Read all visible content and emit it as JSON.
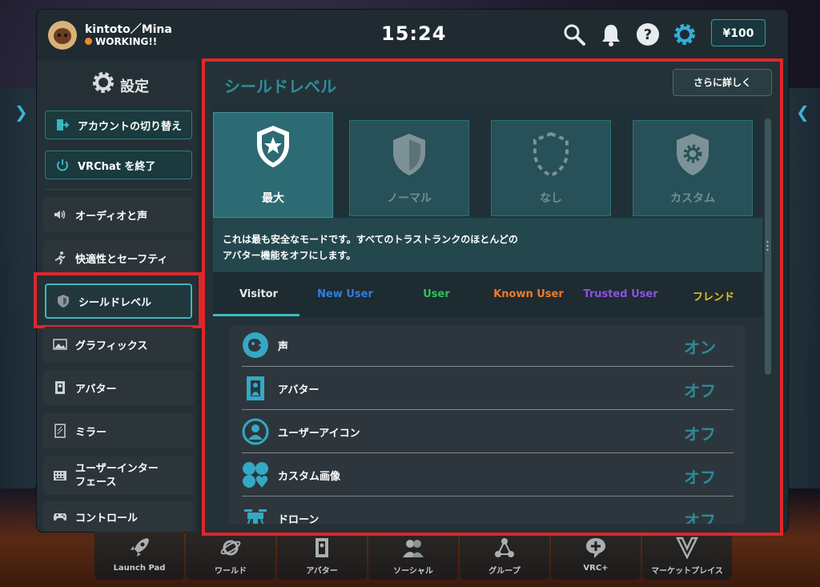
{
  "user": {
    "name": "kintoto／Mina",
    "status": "WORKING!!"
  },
  "clock": "15:24",
  "currency": "¥100",
  "sidebar": {
    "title": "設定",
    "buttons": [
      {
        "label": "アカウントの切り替え",
        "icon": "switch-account-icon"
      },
      {
        "label": "VRChat を終了",
        "icon": "power-icon"
      }
    ],
    "items": [
      {
        "label": "オーディオと声",
        "icon": "speaker-icon"
      },
      {
        "label": "快適性とセーフティ",
        "icon": "running-figure-icon"
      },
      {
        "label": "シールドレベル",
        "icon": "shield-icon"
      },
      {
        "label": "グラフィックス",
        "icon": "image-icon"
      },
      {
        "label": "アバター",
        "icon": "avatar-icon"
      },
      {
        "label": "ミラー",
        "icon": "mirror-icon"
      },
      {
        "label": "ユーザーインター",
        "label2": "フェース",
        "icon": "keyboard-icon"
      },
      {
        "label": "コントロール",
        "icon": "gamepad-icon"
      }
    ]
  },
  "main": {
    "title": "シールドレベル",
    "more_label": "さらに詳しく",
    "shields": [
      {
        "label": "最大",
        "active": true
      },
      {
        "label": "ノーマル"
      },
      {
        "label": "なし"
      },
      {
        "label": "カスタム"
      }
    ],
    "description_line1": "これは最も安全なモードです。すべてのトラストランクのほとんどの",
    "description_line2": "アバター機能をオフにします。",
    "tabs": [
      {
        "label": "Visitor",
        "color": "#e8e8e8"
      },
      {
        "label": "New User",
        "color": "#2f7fe0"
      },
      {
        "label": "User",
        "color": "#2ec35a"
      },
      {
        "label": "Known User",
        "color": "#f07a2a"
      },
      {
        "label": "Trusted User",
        "color": "#8b52e6"
      },
      {
        "label": "フレンド",
        "color": "#e8c422"
      }
    ],
    "rows": [
      {
        "label": "声",
        "value": "オン",
        "icon": "voice-icon"
      },
      {
        "label": "アバター",
        "value": "オフ",
        "icon": "avatar-icon"
      },
      {
        "label": "ユーザーアイコン",
        "value": "オフ",
        "icon": "user-icon"
      },
      {
        "label": "カスタム画像",
        "value": "オフ",
        "icon": "emoji-icon"
      },
      {
        "label": "ドローン",
        "value": "オフ",
        "icon": "drone-icon"
      }
    ]
  },
  "dock": [
    {
      "label": "Launch Pad",
      "icon": "rocket-icon"
    },
    {
      "label": "ワールド",
      "icon": "planet-icon"
    },
    {
      "label": "アバター",
      "icon": "avatar-icon"
    },
    {
      "label": "ソーシャル",
      "icon": "people-icon"
    },
    {
      "label": "グループ",
      "icon": "group-icon"
    },
    {
      "label": "VRC+",
      "icon": "vrc-plus-icon"
    },
    {
      "label": "マーケットプレイス",
      "icon": "marketplace-icon"
    }
  ]
}
